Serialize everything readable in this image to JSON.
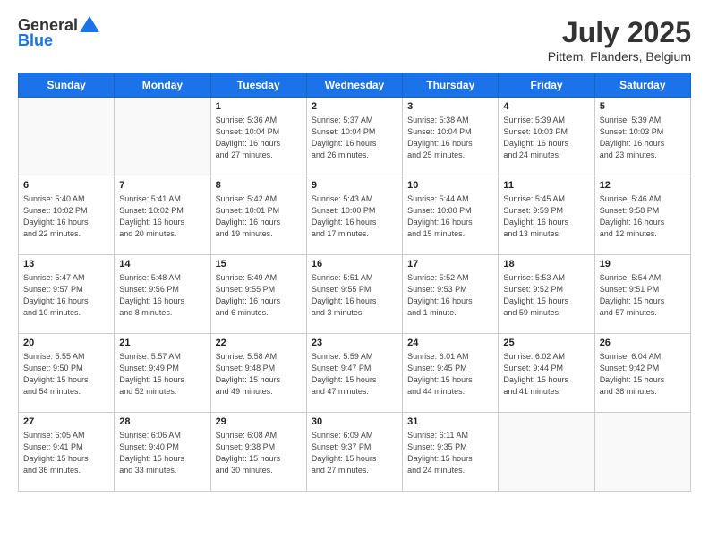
{
  "logo": {
    "general": "General",
    "blue": "Blue"
  },
  "title": "July 2025",
  "location": "Pittem, Flanders, Belgium",
  "headers": [
    "Sunday",
    "Monday",
    "Tuesday",
    "Wednesday",
    "Thursday",
    "Friday",
    "Saturday"
  ],
  "weeks": [
    [
      {
        "day": "",
        "info": ""
      },
      {
        "day": "",
        "info": ""
      },
      {
        "day": "1",
        "info": "Sunrise: 5:36 AM\nSunset: 10:04 PM\nDaylight: 16 hours\nand 27 minutes."
      },
      {
        "day": "2",
        "info": "Sunrise: 5:37 AM\nSunset: 10:04 PM\nDaylight: 16 hours\nand 26 minutes."
      },
      {
        "day": "3",
        "info": "Sunrise: 5:38 AM\nSunset: 10:04 PM\nDaylight: 16 hours\nand 25 minutes."
      },
      {
        "day": "4",
        "info": "Sunrise: 5:39 AM\nSunset: 10:03 PM\nDaylight: 16 hours\nand 24 minutes."
      },
      {
        "day": "5",
        "info": "Sunrise: 5:39 AM\nSunset: 10:03 PM\nDaylight: 16 hours\nand 23 minutes."
      }
    ],
    [
      {
        "day": "6",
        "info": "Sunrise: 5:40 AM\nSunset: 10:02 PM\nDaylight: 16 hours\nand 22 minutes."
      },
      {
        "day": "7",
        "info": "Sunrise: 5:41 AM\nSunset: 10:02 PM\nDaylight: 16 hours\nand 20 minutes."
      },
      {
        "day": "8",
        "info": "Sunrise: 5:42 AM\nSunset: 10:01 PM\nDaylight: 16 hours\nand 19 minutes."
      },
      {
        "day": "9",
        "info": "Sunrise: 5:43 AM\nSunset: 10:00 PM\nDaylight: 16 hours\nand 17 minutes."
      },
      {
        "day": "10",
        "info": "Sunrise: 5:44 AM\nSunset: 10:00 PM\nDaylight: 16 hours\nand 15 minutes."
      },
      {
        "day": "11",
        "info": "Sunrise: 5:45 AM\nSunset: 9:59 PM\nDaylight: 16 hours\nand 13 minutes."
      },
      {
        "day": "12",
        "info": "Sunrise: 5:46 AM\nSunset: 9:58 PM\nDaylight: 16 hours\nand 12 minutes."
      }
    ],
    [
      {
        "day": "13",
        "info": "Sunrise: 5:47 AM\nSunset: 9:57 PM\nDaylight: 16 hours\nand 10 minutes."
      },
      {
        "day": "14",
        "info": "Sunrise: 5:48 AM\nSunset: 9:56 PM\nDaylight: 16 hours\nand 8 minutes."
      },
      {
        "day": "15",
        "info": "Sunrise: 5:49 AM\nSunset: 9:55 PM\nDaylight: 16 hours\nand 6 minutes."
      },
      {
        "day": "16",
        "info": "Sunrise: 5:51 AM\nSunset: 9:55 PM\nDaylight: 16 hours\nand 3 minutes."
      },
      {
        "day": "17",
        "info": "Sunrise: 5:52 AM\nSunset: 9:53 PM\nDaylight: 16 hours\nand 1 minute."
      },
      {
        "day": "18",
        "info": "Sunrise: 5:53 AM\nSunset: 9:52 PM\nDaylight: 15 hours\nand 59 minutes."
      },
      {
        "day": "19",
        "info": "Sunrise: 5:54 AM\nSunset: 9:51 PM\nDaylight: 15 hours\nand 57 minutes."
      }
    ],
    [
      {
        "day": "20",
        "info": "Sunrise: 5:55 AM\nSunset: 9:50 PM\nDaylight: 15 hours\nand 54 minutes."
      },
      {
        "day": "21",
        "info": "Sunrise: 5:57 AM\nSunset: 9:49 PM\nDaylight: 15 hours\nand 52 minutes."
      },
      {
        "day": "22",
        "info": "Sunrise: 5:58 AM\nSunset: 9:48 PM\nDaylight: 15 hours\nand 49 minutes."
      },
      {
        "day": "23",
        "info": "Sunrise: 5:59 AM\nSunset: 9:47 PM\nDaylight: 15 hours\nand 47 minutes."
      },
      {
        "day": "24",
        "info": "Sunrise: 6:01 AM\nSunset: 9:45 PM\nDaylight: 15 hours\nand 44 minutes."
      },
      {
        "day": "25",
        "info": "Sunrise: 6:02 AM\nSunset: 9:44 PM\nDaylight: 15 hours\nand 41 minutes."
      },
      {
        "day": "26",
        "info": "Sunrise: 6:04 AM\nSunset: 9:42 PM\nDaylight: 15 hours\nand 38 minutes."
      }
    ],
    [
      {
        "day": "27",
        "info": "Sunrise: 6:05 AM\nSunset: 9:41 PM\nDaylight: 15 hours\nand 36 minutes."
      },
      {
        "day": "28",
        "info": "Sunrise: 6:06 AM\nSunset: 9:40 PM\nDaylight: 15 hours\nand 33 minutes."
      },
      {
        "day": "29",
        "info": "Sunrise: 6:08 AM\nSunset: 9:38 PM\nDaylight: 15 hours\nand 30 minutes."
      },
      {
        "day": "30",
        "info": "Sunrise: 6:09 AM\nSunset: 9:37 PM\nDaylight: 15 hours\nand 27 minutes."
      },
      {
        "day": "31",
        "info": "Sunrise: 6:11 AM\nSunset: 9:35 PM\nDaylight: 15 hours\nand 24 minutes."
      },
      {
        "day": "",
        "info": ""
      },
      {
        "day": "",
        "info": ""
      }
    ]
  ]
}
